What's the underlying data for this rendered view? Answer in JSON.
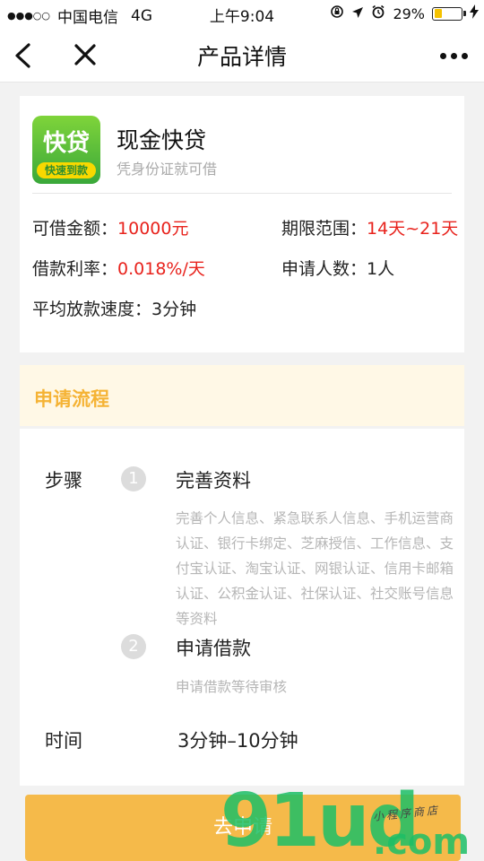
{
  "status_bar": {
    "signal": "●●●○○",
    "carrier": "中国电信",
    "network": "4G",
    "time": "上午9:04",
    "battery_percent": "29%",
    "battery_level": 0.29,
    "icons": [
      "orientation-lock-icon",
      "location-arrow-icon",
      "alarm-clock-icon",
      "battery-icon",
      "charging-bolt-icon"
    ]
  },
  "nav": {
    "title": "产品详情",
    "icons": [
      "back-arrow-icon",
      "close-icon",
      "more-dots-icon"
    ]
  },
  "product": {
    "logo_text": "快贷",
    "logo_subtext": "快速到款",
    "name": "现金快贷",
    "slogan": "凭身份证就可借",
    "amount_label": "可借金额：",
    "amount_value": "10000元",
    "term_label": "期限范围：",
    "term_value": "14天~21天",
    "rate_label": "借款利率：",
    "rate_value": "0.018%/天",
    "applicants_label": "申请人数：",
    "applicants_value": "1人",
    "speed_label": "平均放款速度：",
    "speed_value": "3分钟"
  },
  "process": {
    "title": "申请流程",
    "steps_label": "步骤",
    "steps": [
      {
        "number": "1",
        "title": "完善资料",
        "desc": "完善个人信息、紧急联系人信息、手机运营商认证、银行卡绑定、芝麻授信、工作信息、支付宝认证、淘宝认证、网银认证、信用卡邮箱认证、公积金认证、社保认证、社交账号信息等资料"
      },
      {
        "number": "2",
        "title": "申请借款",
        "desc": "申请借款等待审核"
      }
    ],
    "time_label": "时间",
    "time_value": "3分钟–10分钟"
  },
  "apply_button": "去申请",
  "watermark": {
    "brand": "91ud",
    "domain": ".com",
    "tagline": "小程序商店"
  },
  "colors": {
    "accent_orange": "#f5ba4a",
    "header_title": "#f5b335",
    "value_red": "#e8231d",
    "watermark_green": "#1cbe66"
  }
}
